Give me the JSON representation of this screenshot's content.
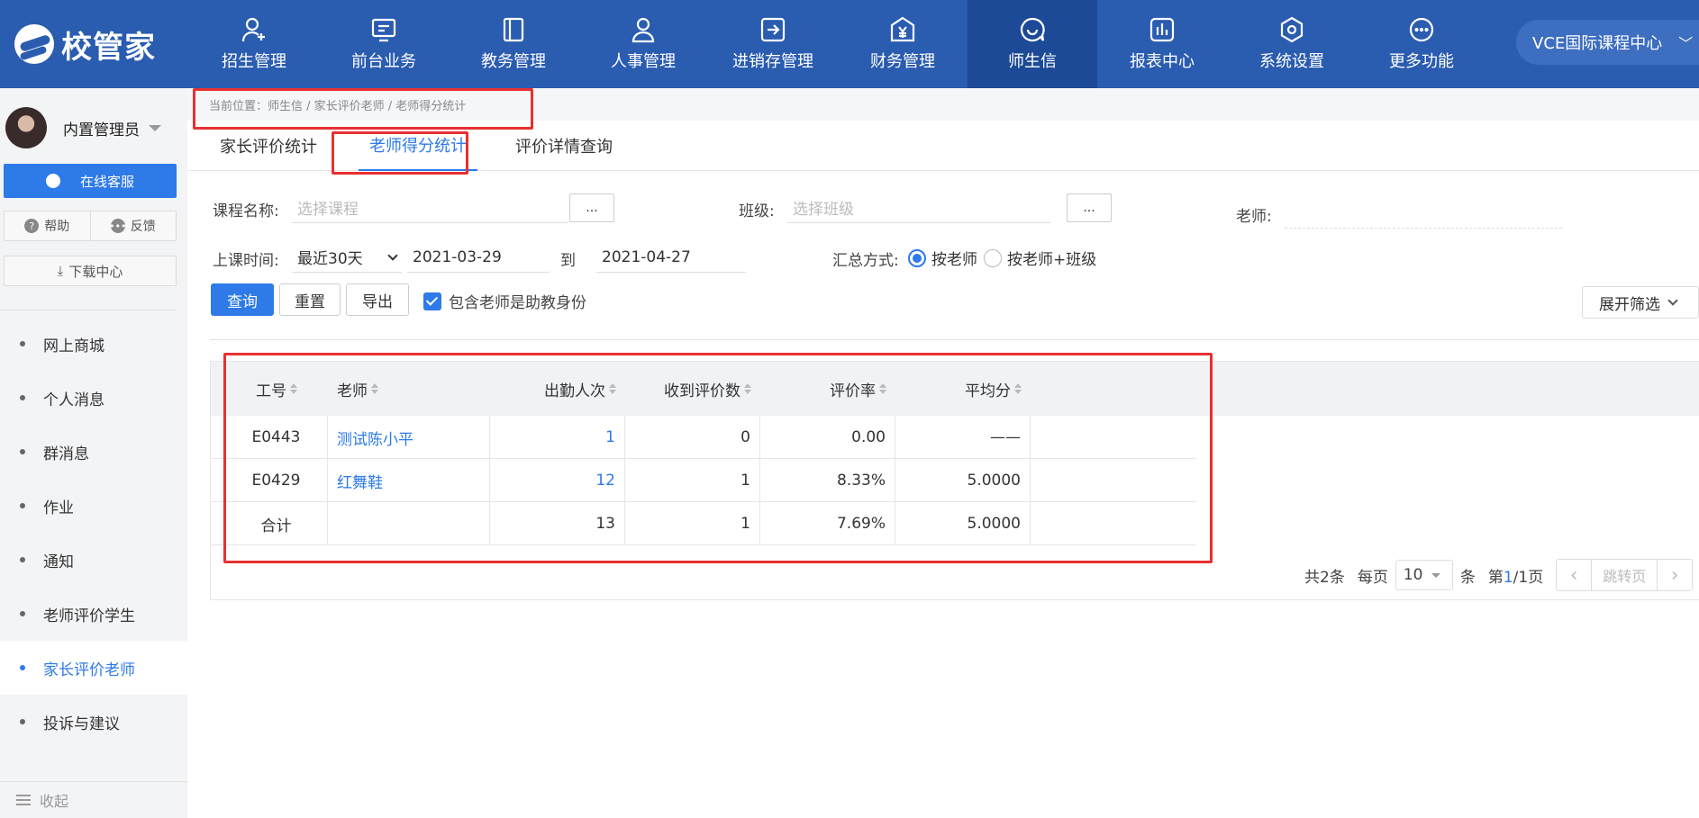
{
  "brand": {
    "name": "校管家"
  },
  "nav": [
    {
      "label": "招生管理",
      "icon": "user-plus-icon"
    },
    {
      "label": "前台业务",
      "icon": "monitor-icon"
    },
    {
      "label": "教务管理",
      "icon": "book-icon"
    },
    {
      "label": "人事管理",
      "icon": "person-icon"
    },
    {
      "label": "进销存管理",
      "icon": "login-arrow-icon"
    },
    {
      "label": "财务管理",
      "icon": "yen-house-icon"
    },
    {
      "label": "师生信",
      "icon": "chat-icon",
      "active": true
    },
    {
      "label": "报表中心",
      "icon": "bar-chart-icon"
    },
    {
      "label": "系统设置",
      "icon": "settings-icon"
    },
    {
      "label": "更多功能",
      "icon": "more-icon"
    }
  ],
  "org": {
    "name": "VCE国际课程中心"
  },
  "sidebar": {
    "user": "内置管理员",
    "online_service": "在线客服",
    "help": "帮助",
    "feedback": "反馈",
    "download": "下载中心",
    "menu": [
      {
        "label": "网上商城"
      },
      {
        "label": "个人消息"
      },
      {
        "label": "群消息"
      },
      {
        "label": "作业"
      },
      {
        "label": "通知"
      },
      {
        "label": "老师评价学生"
      },
      {
        "label": "家长评价老师",
        "active": true
      },
      {
        "label": "投诉与建议"
      }
    ],
    "collapse": "收起"
  },
  "breadcrumb": "当前位置：师生信 / 家长评价老师 / 老师得分统计",
  "tabs": [
    {
      "label": "家长评价统计"
    },
    {
      "label": "老师得分统计",
      "active": true
    },
    {
      "label": "评价详情查询"
    }
  ],
  "filters": {
    "course_label": "课程名称:",
    "course_placeholder": "选择课程",
    "dots": "...",
    "class_label": "班级:",
    "class_placeholder": "选择班级",
    "teacher_label": "老师:",
    "time_label": "上课时间:",
    "time_range": "最近30天",
    "date_from": "2021-03-29",
    "to": "到",
    "date_to": "2021-04-27",
    "summary_label": "汇总方式:",
    "opt_teacher": "按老师",
    "opt_teacher_class": "按老师+班级"
  },
  "actions": {
    "query": "查询",
    "reset": "重置",
    "export": "导出",
    "include_assistant": "包含老师是助教身份",
    "expand_filter": "展开筛选"
  },
  "table": {
    "headers": [
      "工号",
      "老师",
      "出勤人次",
      "收到评价数",
      "评价率",
      "平均分"
    ],
    "rows": [
      {
        "id": "E0443",
        "teacher": "测试陈小平",
        "attend": "1",
        "reviews": "0",
        "rate": "0.00",
        "avg": "——"
      },
      {
        "id": "E0429",
        "teacher": "红舞鞋",
        "attend": "12",
        "reviews": "1",
        "rate": "8.33%",
        "avg": "5.0000"
      }
    ],
    "total": {
      "id": "合计",
      "teacher": "",
      "attend": "13",
      "reviews": "1",
      "rate": "7.69%",
      "avg": "5.0000"
    }
  },
  "pager": {
    "total": "共2条",
    "per_page_label": "每页",
    "per_page": "10",
    "unit": "条",
    "page_prefix": "第",
    "page_cur": "1",
    "page_suffix": "/1页",
    "jump": "跳转页"
  },
  "colors": {
    "topbar": "#2a5cb0",
    "accent": "#2d7ae8",
    "highlight": "#e83030"
  }
}
